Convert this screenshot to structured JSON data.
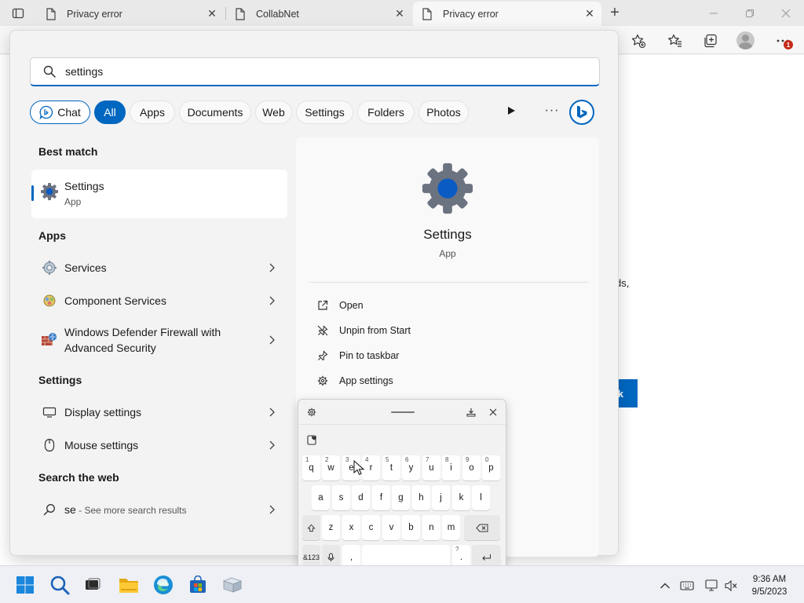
{
  "browser": {
    "tabs": [
      {
        "title": "Privacy error",
        "active": false
      },
      {
        "title": "CollabNet",
        "active": false
      },
      {
        "title": "Privacy error",
        "active": true
      }
    ],
    "notification_count": "1"
  },
  "page": {
    "partial_text": "ds,",
    "partial_button": "k"
  },
  "search": {
    "query": "settings",
    "filters": [
      "Chat",
      "All",
      "Apps",
      "Documents",
      "Web",
      "Settings",
      "Folders",
      "Photos"
    ],
    "more_label": "···"
  },
  "results": {
    "best_match_heading": "Best match",
    "best_match": {
      "title": "Settings",
      "subtitle": "App"
    },
    "apps_heading": "Apps",
    "apps": [
      {
        "label": "Services"
      },
      {
        "label": "Component Services"
      },
      {
        "label": "Windows Defender Firewall with Advanced Security"
      }
    ],
    "settings_heading": "Settings",
    "settings": [
      {
        "label": "Display settings"
      },
      {
        "label": "Mouse settings"
      }
    ],
    "web_heading": "Search the web",
    "web": {
      "query": "se",
      "suffix": " - See more search results"
    }
  },
  "detail": {
    "title": "Settings",
    "subtitle": "App",
    "actions": [
      "Open",
      "Unpin from Start",
      "Pin to taskbar",
      "App settings"
    ]
  },
  "keyboard": {
    "row1": [
      "q",
      "w",
      "e",
      "r",
      "t",
      "y",
      "u",
      "i",
      "o",
      "p"
    ],
    "row1_hints": [
      "1",
      "2",
      "3",
      "4",
      "5",
      "6",
      "7",
      "8",
      "9",
      "0"
    ],
    "row2": [
      "a",
      "s",
      "d",
      "f",
      "g",
      "h",
      "j",
      "k",
      "l"
    ],
    "row3": [
      "z",
      "x",
      "c",
      "v",
      "b",
      "n",
      "m"
    ],
    "sym_label": "&123",
    "comma": ",",
    "period": ".",
    "period_hint": "?"
  },
  "clock": {
    "time": "9:36 AM",
    "date": "9/5/2023"
  },
  "colors": {
    "accent": "#0067c0",
    "badge": "#c42b1c"
  }
}
